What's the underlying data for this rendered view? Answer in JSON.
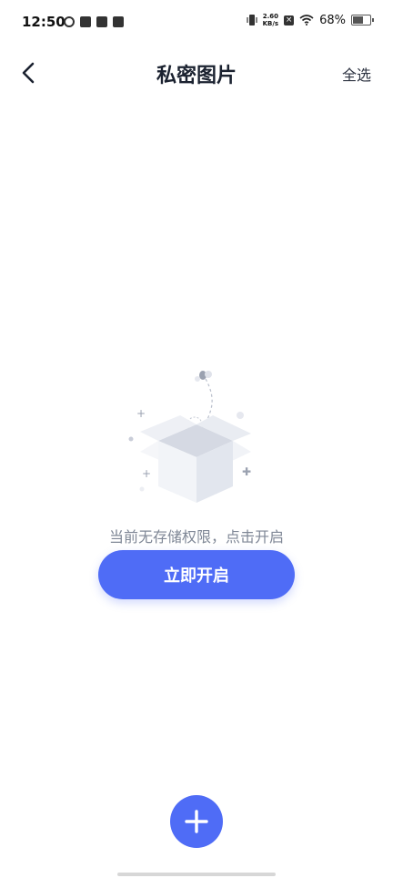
{
  "status_bar": {
    "time": "12:50",
    "speed_value": "2.60",
    "speed_unit": "KB/s",
    "battery": "68%"
  },
  "header": {
    "back_icon": "chevron-left-icon",
    "title": "私密图片",
    "select_all": "全选"
  },
  "empty_state": {
    "illustration": "open-box-icon",
    "message": "当前无存储权限，点击开启",
    "button_label": "立即开启"
  },
  "fab": {
    "icon": "plus-icon"
  },
  "colors": {
    "accent": "#4f6cf6",
    "text_primary": "#1b2230",
    "text_secondary": "#7f8796"
  }
}
